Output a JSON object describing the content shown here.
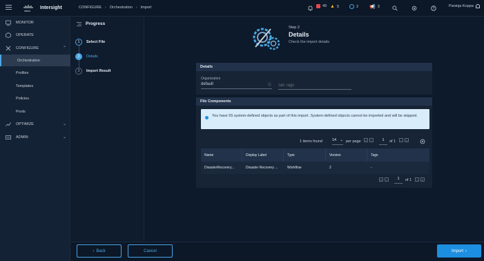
{
  "header": {
    "brand": "Intersight",
    "breadcrumb": [
      "CONFIGURE",
      "Orchestration",
      "Import"
    ],
    "alerts_critical": "49",
    "alerts_warning": "5",
    "requests": "2",
    "announcements": "3",
    "user_name": "Paninja Koppa",
    "colors": {
      "critical": "#e5484d",
      "warning": "#f0b429",
      "accent": "#4aa7e6"
    }
  },
  "sidebar": {
    "items": [
      {
        "label": "MONITOR",
        "icon": "monitor-icon"
      },
      {
        "label": "OPERATE",
        "icon": "operate-icon"
      },
      {
        "label": "CONFIGURE",
        "icon": "configure-icon"
      },
      {
        "label": "Orchestration"
      },
      {
        "label": "Profiles"
      },
      {
        "label": "Templates"
      },
      {
        "label": "Policies"
      },
      {
        "label": "Pools"
      },
      {
        "label": "OPTIMIZE",
        "icon": "optimize-icon"
      },
      {
        "label": "ADMIN",
        "icon": "admin-icon"
      }
    ]
  },
  "wizard": {
    "progress_title": "Progress",
    "steps": [
      {
        "num": "1",
        "label": "Select File"
      },
      {
        "num": "2",
        "label": "Details"
      },
      {
        "num": "3",
        "label": "Import Result"
      }
    ],
    "step_label": "Step 2",
    "title": "Details",
    "subtitle": "Check the import details"
  },
  "details": {
    "header": "Details",
    "org_label": "Organization",
    "org_value": "default",
    "tags_placeholder": "Set Tags"
  },
  "components": {
    "header": "File Components",
    "info": "You have 55 system-defined objects as part of this import. System-defined objects cannot be imported and will be skipped.",
    "items_found": "1 items found",
    "per_page_value": "14",
    "per_page_label": "per page",
    "page_current": "1",
    "page_total": "of 1",
    "columns": [
      "Name",
      "Display Label",
      "Type",
      "Version",
      "Tags"
    ],
    "rows": [
      {
        "name": "DisasterRecovery...",
        "label": "Disaster Recovery ...",
        "type": "Workflow",
        "version": "2",
        "tags": "-"
      }
    ]
  },
  "footer": {
    "back": "Back",
    "cancel": "Cancel",
    "import": "Import"
  }
}
